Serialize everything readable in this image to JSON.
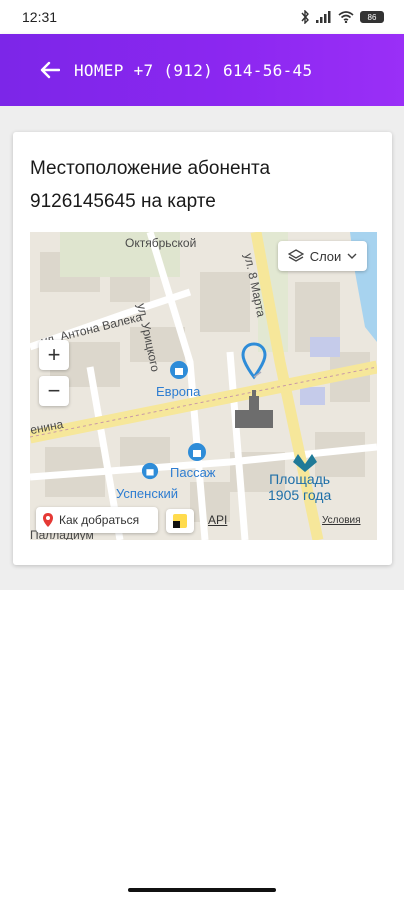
{
  "status_bar": {
    "time": "12:31",
    "battery": "86"
  },
  "app_bar": {
    "title": "НОМЕР +7 (912) 614-56-45"
  },
  "card": {
    "title": "Местоположение абонента 9126145645 на карте"
  },
  "map": {
    "streets": [
      "Октябрьской",
      "ул. Антона Валека",
      "ул. Урицкого",
      "ул. 8 Марта",
      "енина",
      "Палладиум"
    ],
    "pois": [
      "Европа",
      "Пассаж",
      "Успенский"
    ],
    "metro": "Площадь\n1905 года",
    "controls": {
      "layers_label": "Слои",
      "zoom_in": "+",
      "zoom_out": "−",
      "route_label": "Как добраться",
      "api_label": "API",
      "terms_label": "Условия"
    }
  },
  "colors": {
    "accent": "#8a2be2",
    "pin": "#2e8cd8"
  }
}
